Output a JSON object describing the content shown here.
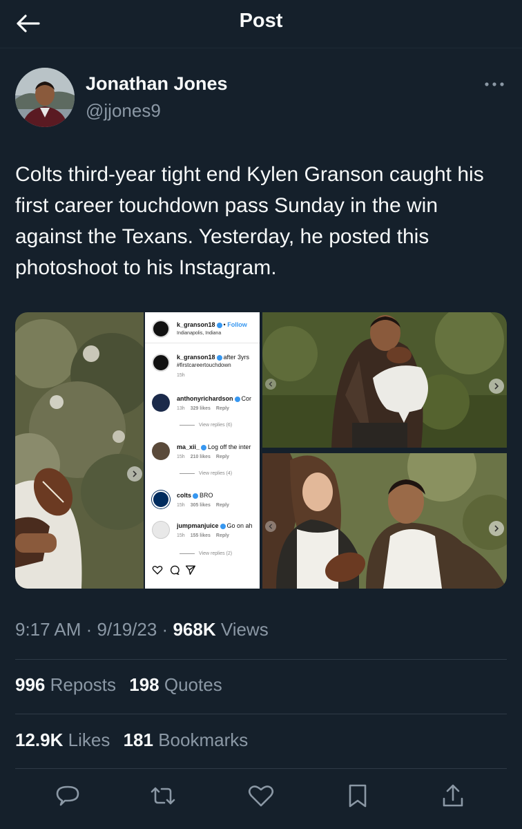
{
  "header": {
    "title": "Post"
  },
  "author": {
    "name": "Jonathan Jones",
    "handle": "@jjones9"
  },
  "post": {
    "text": "Colts third-year tight end Kylen Granson caught his first career touchdown pass Sunday in the win against the Texans. Yesterday, he posted this photoshoot to his Instagram."
  },
  "instagram": {
    "header": {
      "username": "k_granson18",
      "dot": "•",
      "follow": "Follow",
      "location": "Indianapolis, Indiana"
    },
    "caption": {
      "username": "k_granson18",
      "text": "after 3yrs",
      "hashtag": "#firstcareertouchdown",
      "time": "15h"
    },
    "comments": [
      {
        "username": "anthonyrichardson",
        "text": "Cor",
        "time": "13h",
        "likes": "329 likes",
        "reply": "Reply",
        "view_replies": "View replies (6)"
      },
      {
        "username": "ma_xii_",
        "text": "Log off the inter",
        "time": "15h",
        "likes": "210 likes",
        "reply": "Reply",
        "view_replies": "View replies (4)"
      },
      {
        "username": "colts",
        "text": "BRO",
        "time": "15h",
        "likes": "305 likes",
        "reply": "Reply",
        "view_replies": ""
      },
      {
        "username": "jumpmanjuice",
        "text": "Go on ah",
        "time": "15h",
        "likes": "155 likes",
        "reply": "Reply",
        "view_replies": "View replies (2)"
      }
    ]
  },
  "meta": {
    "time": "9:17 AM",
    "sep": "·",
    "date": "9/19/23",
    "views_count": "968K",
    "views_label": "Views"
  },
  "stats": {
    "reposts_count": "996",
    "reposts_label": "Reposts",
    "quotes_count": "198",
    "quotes_label": "Quotes",
    "likes_count": "12.9K",
    "likes_label": "Likes",
    "bookmarks_count": "181",
    "bookmarks_label": "Bookmarks"
  },
  "colors": {
    "background": "#15202b",
    "text": "#f7f9f9",
    "muted": "#8b98a5",
    "divider": "#2f3b47",
    "ig_blue": "#3797f0"
  },
  "icons": [
    "back-arrow-icon",
    "more-icon",
    "reply-icon",
    "repost-icon",
    "like-icon",
    "bookmark-icon",
    "share-icon"
  ]
}
